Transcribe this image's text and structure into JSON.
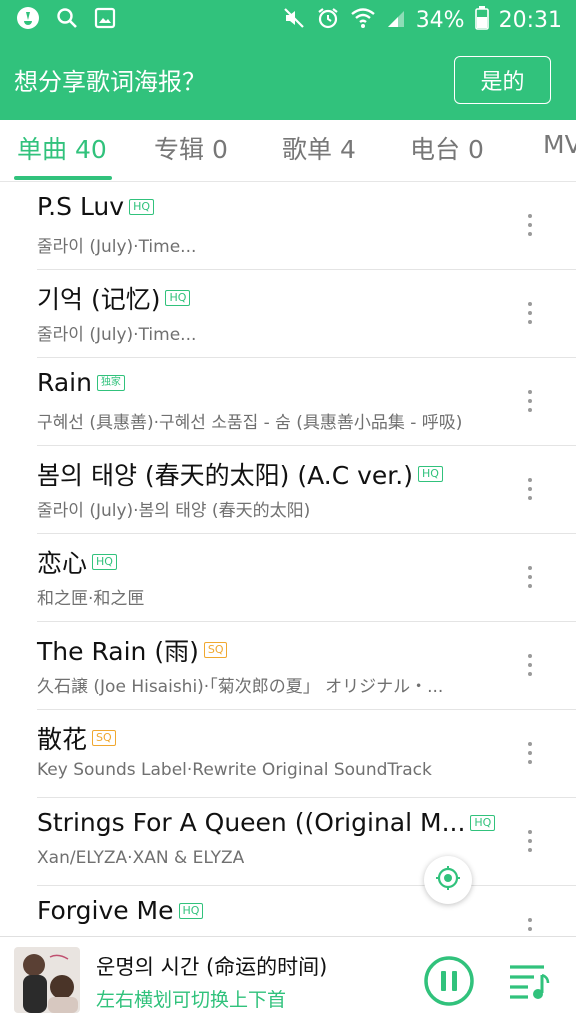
{
  "status_bar": {
    "battery": "34%",
    "time": "20:31",
    "icons_left": [
      "app-icon",
      "search-icon",
      "image-icon"
    ],
    "icons_right": [
      "mute-icon",
      "alarm-icon",
      "wifi-icon",
      "signal-icon",
      "battery-icon"
    ]
  },
  "banner": {
    "text": "想分享歌词海报？",
    "button": "是的"
  },
  "tabs": [
    {
      "label": "单曲 40",
      "active": true
    },
    {
      "label": "专辑 0",
      "active": false
    },
    {
      "label": "歌单 4",
      "active": false
    },
    {
      "label": "电台 0",
      "active": false
    },
    {
      "label": "MV",
      "active": false
    }
  ],
  "songs": [
    {
      "title": "P.S Luv",
      "badge": "HQ",
      "subtitle": "줄라이 (July)·Time..."
    },
    {
      "title": "기억 (记忆)",
      "badge": "HQ",
      "subtitle": "줄라이 (July)·Time..."
    },
    {
      "title": "Rain",
      "badge": "独家",
      "subtitle": "구혜선 (具惠善)·구혜선 소품집 - 숨 (具惠善小品集 - 呼吸)"
    },
    {
      "title": "봄의 태양 (春天的太阳) (A.C ver.)",
      "badge": "HQ",
      "subtitle": "줄라이 (July)·봄의 태양 (春天的太阳)"
    },
    {
      "title": "恋心",
      "badge": "HQ",
      "subtitle": "和之匣·和之匣"
    },
    {
      "title": "The Rain (雨)",
      "badge": "SQ",
      "subtitle": "久石譲 (Joe Hisaishi)·「菊次郎の夏」 オリジナル・..."
    },
    {
      "title": "散花",
      "badge": "SQ",
      "subtitle": "Key Sounds Label·Rewrite Original SoundTrack"
    },
    {
      "title": "Strings For A Queen ((Original M...",
      "badge": "HQ",
      "subtitle": "Xan/ELYZA·XAN & ELYZA"
    },
    {
      "title": "Forgive Me",
      "badge": "HQ",
      "subtitle": ""
    }
  ],
  "player": {
    "title": "운명의 시간 (命运的时间)",
    "hint": "左右横划可切换上下首"
  },
  "colors": {
    "accent": "#31c27c",
    "sq": "#f0a830"
  }
}
